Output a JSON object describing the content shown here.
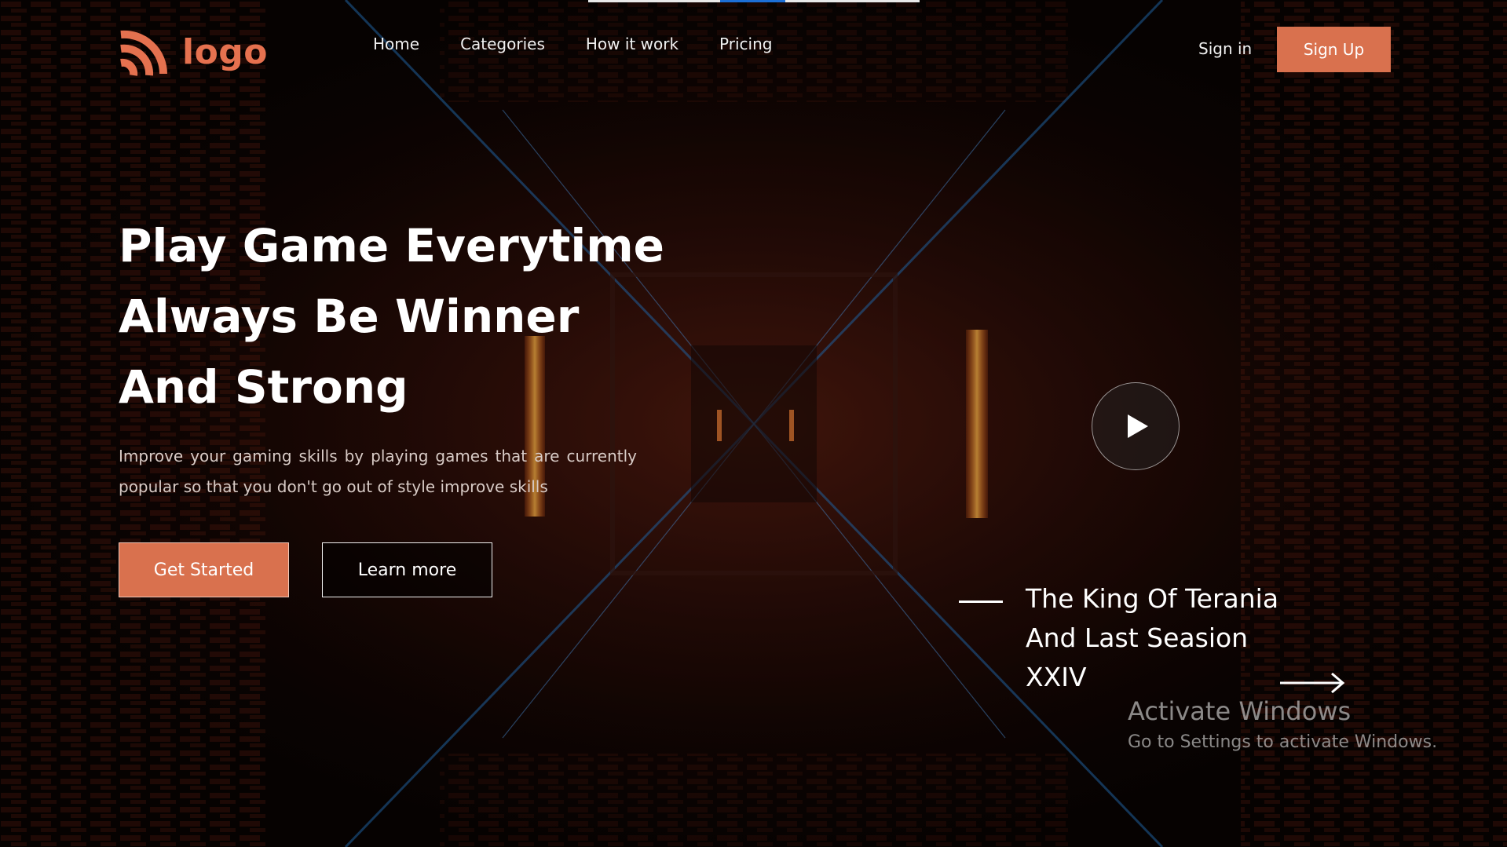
{
  "header": {
    "logo_text": "logo",
    "logo_icon": "rss-waves-icon",
    "nav": [
      "Home",
      "Categories",
      "How it work",
      "Pricing"
    ],
    "signin_label": "Sign in",
    "signup_label": "Sign Up"
  },
  "hero": {
    "title_lines": [
      "Play Game Everytime",
      "Always Be Winner",
      "And Strong"
    ],
    "subtitle": "Improve your gaming skills by playing games that are currently popular so that you don't go out of style improve skills",
    "primary_button": "Get Started",
    "secondary_button": "Learn more"
  },
  "featured": {
    "title_lines": [
      "The King Of Terania",
      "And Last Seasion",
      "XXIV"
    ],
    "play_icon": "play-icon",
    "arrow_icon": "arrow-right-icon"
  },
  "system_overlay": {
    "title": "Activate Windows",
    "subtitle": "Go to Settings to activate Windows."
  },
  "colors": {
    "accent": "#d9714e",
    "background": "#0a0504",
    "text": "#ffffff"
  }
}
